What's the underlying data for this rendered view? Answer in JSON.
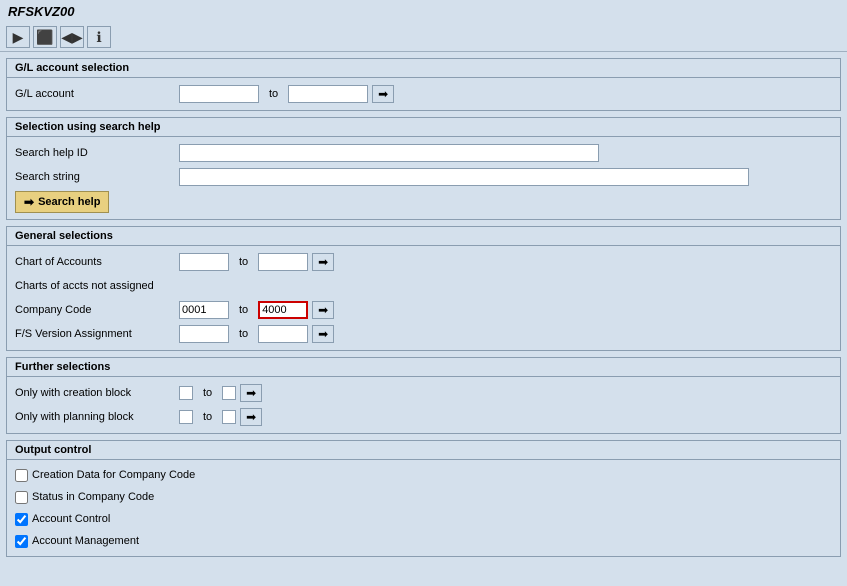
{
  "titleBar": {
    "title": "RFSKVZ00"
  },
  "toolbar": {
    "buttons": [
      {
        "name": "execute-icon",
        "symbol": "▶",
        "label": "Execute"
      },
      {
        "name": "save-icon",
        "symbol": "💾",
        "label": "Save"
      },
      {
        "name": "back-icon",
        "symbol": "◀",
        "label": "Back"
      },
      {
        "name": "info-icon",
        "symbol": "ℹ",
        "label": "Info"
      }
    ]
  },
  "sections": {
    "glAccountSelection": {
      "header": "G/L account selection",
      "fields": [
        {
          "label": "G/L account",
          "inputFrom": "",
          "inputTo": "",
          "hasArrow": true
        }
      ]
    },
    "selectionUsingSearchHelp": {
      "header": "Selection using search help",
      "searchHelpIdLabel": "Search help ID",
      "searchHelpIdValue": "",
      "searchStringLabel": "Search string",
      "searchStringValue": "",
      "buttonLabel": "Search help",
      "buttonIcon": "➡"
    },
    "generalSelections": {
      "header": "General selections",
      "fields": [
        {
          "label": "Chart of Accounts",
          "inputFrom": "",
          "inputTo": "",
          "hasArrow": true,
          "inputFromWidth": "small",
          "inputToWidth": "small"
        },
        {
          "label": "Charts of accts not assigned",
          "inputFrom": null,
          "inputTo": null,
          "hasArrow": false,
          "noInput": true
        },
        {
          "label": "Company Code",
          "inputFrom": "0001",
          "inputTo": "4000",
          "hasArrow": true,
          "inputFromWidth": "small",
          "inputToWidth": "small",
          "inputToRedBorder": true
        },
        {
          "label": "F/S Version Assignment",
          "inputFrom": "",
          "inputTo": "",
          "hasArrow": true,
          "inputFromWidth": "small",
          "inputToWidth": "small"
        }
      ]
    },
    "furtherSelections": {
      "header": "Further selections",
      "fields": [
        {
          "label": "Only with creation block",
          "inputFrom": "",
          "inputTo": "",
          "hasArrow": true
        },
        {
          "label": "Only with planning block",
          "inputFrom": "",
          "inputTo": "",
          "hasArrow": true
        }
      ]
    },
    "outputControl": {
      "header": "Output control",
      "checkboxes": [
        {
          "label": "Creation Data for Company Code",
          "checked": false
        },
        {
          "label": "Status in Company Code",
          "checked": false
        },
        {
          "label": "Account Control",
          "checked": true
        },
        {
          "label": "Account Management",
          "checked": true
        }
      ]
    }
  }
}
